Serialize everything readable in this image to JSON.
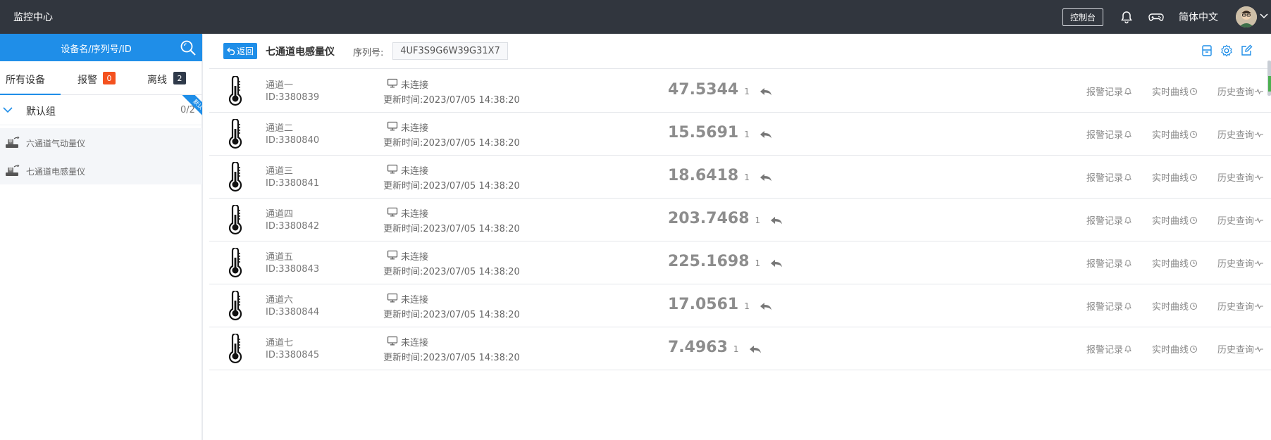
{
  "topbar": {
    "brand": "监控中心",
    "console_label": "控制台",
    "language": "简体中文"
  },
  "sidebar": {
    "search_label": "设备名/序列号/ID",
    "tabs": [
      {
        "label": "所有设备"
      },
      {
        "label": "报警",
        "badge": "0"
      },
      {
        "label": "离线",
        "badge": "2"
      }
    ],
    "group": {
      "name": "默认组",
      "count": "0/2",
      "ribbon": "默认"
    },
    "devices": [
      {
        "name": "六通道气动量仪"
      },
      {
        "name": "七通道电感量仪"
      }
    ]
  },
  "header": {
    "back_label": "返回",
    "device_title": "七通道电感量仪",
    "serial_label": "序列号:",
    "serial_value": "4UF3S9G6W39G31X7"
  },
  "actions": {
    "alarm": "报警记录",
    "realtime": "实时曲线",
    "history": "历史查询"
  },
  "channels": [
    {
      "name": "通道一",
      "id": "ID:3380839",
      "status": "未连接",
      "updated": "更新时间:2023/07/05 14:38:20",
      "value": "47.5344",
      "unit": "1"
    },
    {
      "name": "通道二",
      "id": "ID:3380840",
      "status": "未连接",
      "updated": "更新时间:2023/07/05 14:38:20",
      "value": "15.5691",
      "unit": "1"
    },
    {
      "name": "通道三",
      "id": "ID:3380841",
      "status": "未连接",
      "updated": "更新时间:2023/07/05 14:38:20",
      "value": "18.6418",
      "unit": "1"
    },
    {
      "name": "通道四",
      "id": "ID:3380842",
      "status": "未连接",
      "updated": "更新时间:2023/07/05 14:38:20",
      "value": "203.7468",
      "unit": "1"
    },
    {
      "name": "通道五",
      "id": "ID:3380843",
      "status": "未连接",
      "updated": "更新时间:2023/07/05 14:38:20",
      "value": "225.1698",
      "unit": "1"
    },
    {
      "name": "通道六",
      "id": "ID:3380844",
      "status": "未连接",
      "updated": "更新时间:2023/07/05 14:38:20",
      "value": "17.0561",
      "unit": "1"
    },
    {
      "name": "通道七",
      "id": "ID:3380845",
      "status": "未连接",
      "updated": "更新时间:2023/07/05 14:38:20",
      "value": "7.4963",
      "unit": "1"
    }
  ],
  "colors": {
    "accent": "#1f8ee8",
    "topbar": "#31363e",
    "alarm_badge": "#f4511e"
  }
}
